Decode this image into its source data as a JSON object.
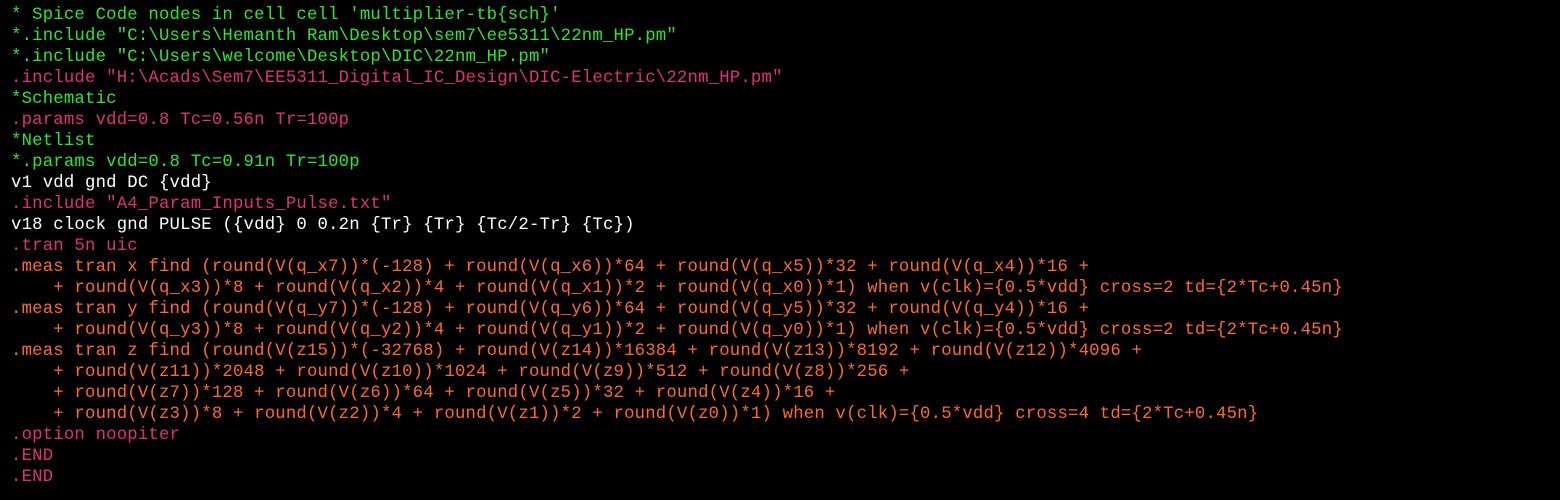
{
  "editor": {
    "colors": {
      "background": "#000000",
      "comment": "#2ee62e",
      "inactive_directive": "#e0307a",
      "normal": "#ffffff",
      "directive": "#e0307a",
      "measure": "#ff6a2a"
    },
    "lines": [
      {
        "text": "* Spice Code nodes in cell cell 'multiplier-tb{sch}'",
        "style": "comment"
      },
      {
        "text": "*.include \"C:\\Users\\Hemanth Ram\\Desktop\\sem7\\ee5311\\22nm_HP.pm\"",
        "style": "comment"
      },
      {
        "text": "*.include \"C:\\Users\\welcome\\Desktop\\DIC\\22nm_HP.pm\"",
        "style": "comment"
      },
      {
        "text": ".include \"H:\\Acads\\Sem7\\EE5311_Digital_IC_Design\\DIC-Electric\\22nm_HP.pm\"",
        "style": "directive"
      },
      {
        "text": "*Schematic",
        "style": "comment"
      },
      {
        "text": ".params vdd=0.8 Tc=0.56n Tr=100p",
        "style": "directive"
      },
      {
        "text": "*Netlist",
        "style": "comment"
      },
      {
        "text": "*.params vdd=0.8 Tc=0.91n Tr=100p",
        "style": "comment"
      },
      {
        "text": "v1 vdd gnd DC {vdd}",
        "style": "normal"
      },
      {
        "text": ".include \"A4_Param_Inputs_Pulse.txt\"",
        "style": "directive"
      },
      {
        "text": "v18 clock gnd PULSE ({vdd} 0 0.2n {Tr} {Tr} {Tc/2-Tr} {Tc})",
        "style": "normal"
      },
      {
        "text": ".tran 5n uic",
        "style": "directive"
      },
      {
        "text": ".meas tran x find (round(V(q_x7))*(-128) + round(V(q_x6))*64 + round(V(q_x5))*32 + round(V(q_x4))*16 +",
        "style": "meas"
      },
      {
        "text": "    + round(V(q_x3))*8 + round(V(q_x2))*4 + round(V(q_x1))*2 + round(V(q_x0))*1) when v(clk)={0.5*vdd} cross=2 td={2*Tc+0.45n}",
        "style": "meas"
      },
      {
        "text": ".meas tran y find (round(V(q_y7))*(-128) + round(V(q_y6))*64 + round(V(q_y5))*32 + round(V(q_y4))*16 +",
        "style": "meas"
      },
      {
        "text": "    + round(V(q_y3))*8 + round(V(q_y2))*4 + round(V(q_y1))*2 + round(V(q_y0))*1) when v(clk)={0.5*vdd} cross=2 td={2*Tc+0.45n}",
        "style": "meas"
      },
      {
        "text": ".meas tran z find (round(V(z15))*(-32768) + round(V(z14))*16384 + round(V(z13))*8192 + round(V(z12))*4096 +",
        "style": "meas"
      },
      {
        "text": "    + round(V(z11))*2048 + round(V(z10))*1024 + round(V(z9))*512 + round(V(z8))*256 +",
        "style": "meas"
      },
      {
        "text": "    + round(V(z7))*128 + round(V(z6))*64 + round(V(z5))*32 + round(V(z4))*16 +",
        "style": "meas"
      },
      {
        "text": "    + round(V(z3))*8 + round(V(z2))*4 + round(V(z1))*2 + round(V(z0))*1) when v(clk)={0.5*vdd} cross=4 td={2*Tc+0.45n}",
        "style": "meas"
      },
      {
        "text": ".option noopiter",
        "style": "directive"
      },
      {
        "text": ".END",
        "style": "directive"
      },
      {
        "text": ".END",
        "style": "directive"
      }
    ]
  }
}
